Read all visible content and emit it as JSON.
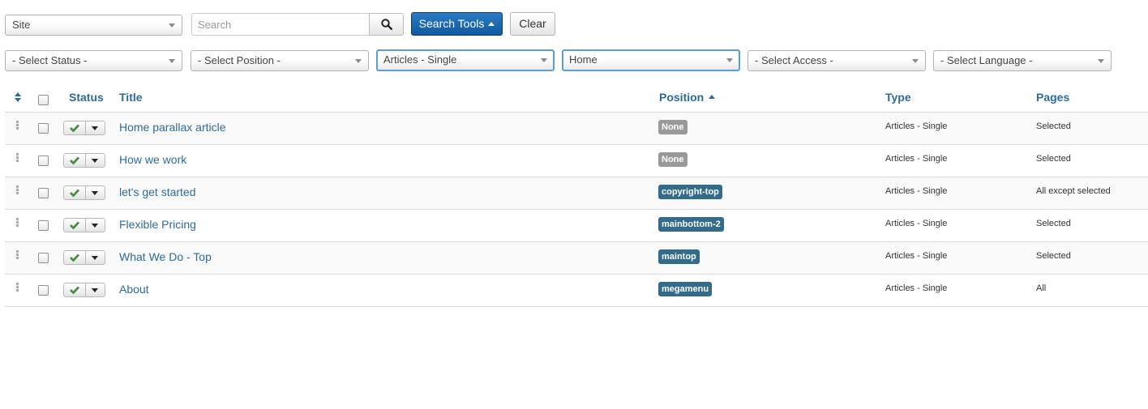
{
  "filters": {
    "client": "Site",
    "search_placeholder": "Search",
    "search_tools_label": "Search Tools",
    "clear_label": "Clear",
    "status": "- Select Status -",
    "position": "- Select Position -",
    "module_type": "Articles - Single",
    "menu_item": "Home",
    "access": "- Select Access -",
    "language": "- Select Language -"
  },
  "table": {
    "headers": {
      "status": "Status",
      "title": "Title",
      "position": "Position",
      "type": "Type",
      "pages": "Pages"
    },
    "rows": [
      {
        "title": "Home parallax article",
        "position": "None",
        "type": "Articles - Single",
        "pages": "Selected"
      },
      {
        "title": "How we work",
        "position": "None",
        "type": "Articles - Single",
        "pages": "Selected"
      },
      {
        "title": "let's get started",
        "position": "copyright-top",
        "type": "Articles - Single",
        "pages": "All except selected"
      },
      {
        "title": "Flexible Pricing",
        "position": "mainbottom-2",
        "type": "Articles - Single",
        "pages": "Selected"
      },
      {
        "title": "What We Do - Top",
        "position": "maintop",
        "type": "Articles - Single",
        "pages": "Selected"
      },
      {
        "title": "About",
        "position": "megamenu",
        "type": "Articles - Single",
        "pages": "All"
      }
    ]
  },
  "colors": {
    "link": "#2d6b9b",
    "badge_none": "#999999",
    "badge_position": "#336b8b",
    "published_check": "#3f8a3a",
    "primary_button": "#1d6bb3"
  },
  "icons": {
    "search_button": "search-icon",
    "sort_header": "sort-icon",
    "row_drag": "drag-handle-icon",
    "published": "check-icon",
    "status_menu": "caret-down-icon"
  }
}
